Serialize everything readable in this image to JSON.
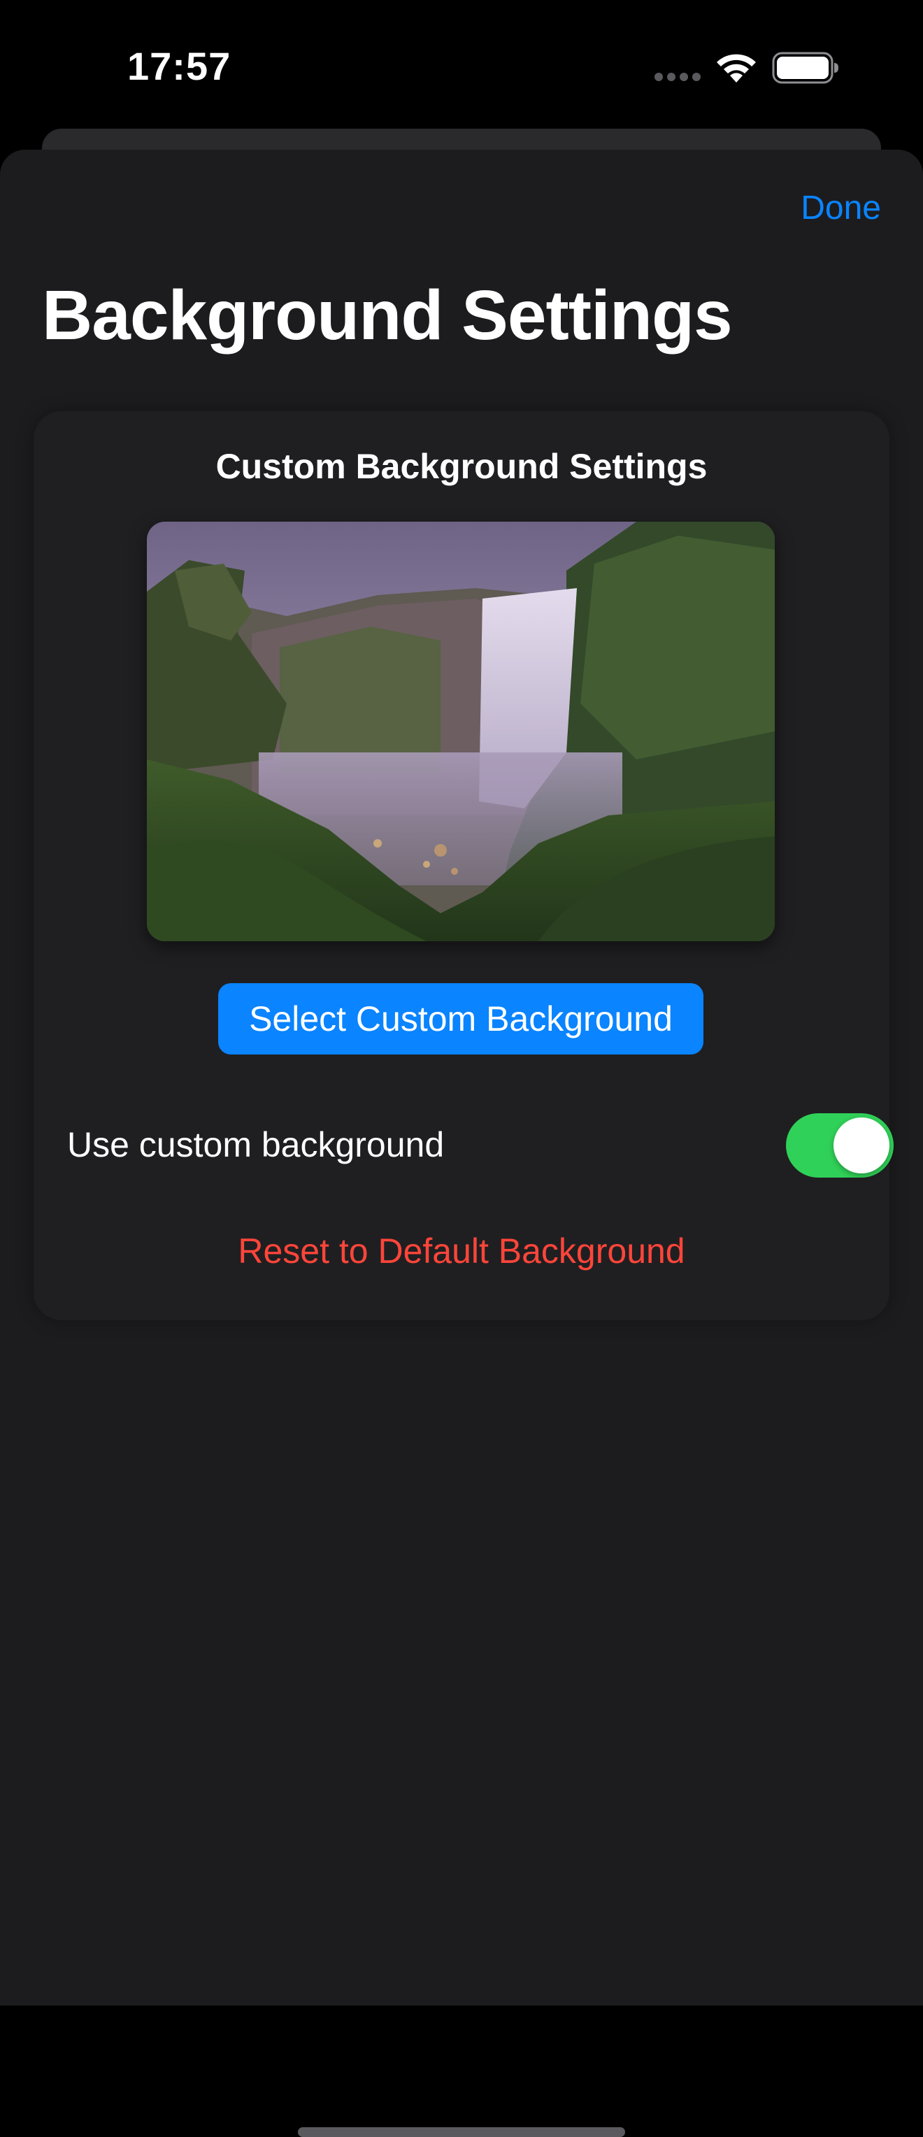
{
  "status_bar": {
    "time": "17:57",
    "icons": [
      "cellular-dots-icon",
      "wifi-icon",
      "battery-icon"
    ]
  },
  "sheet": {
    "done_label": "Done",
    "title": "Background Settings"
  },
  "card": {
    "title": "Custom Background Settings",
    "preview_image": "waterfall landscape preview",
    "select_button_label": "Select Custom Background",
    "toggle_label": "Use custom background",
    "toggle_on": true,
    "reset_label": "Reset to Default Background"
  },
  "colors": {
    "accent": "#0a84ff",
    "toggle_on": "#30d158",
    "destructive": "#ff453a",
    "sheet_background": "#1c1c1e"
  }
}
